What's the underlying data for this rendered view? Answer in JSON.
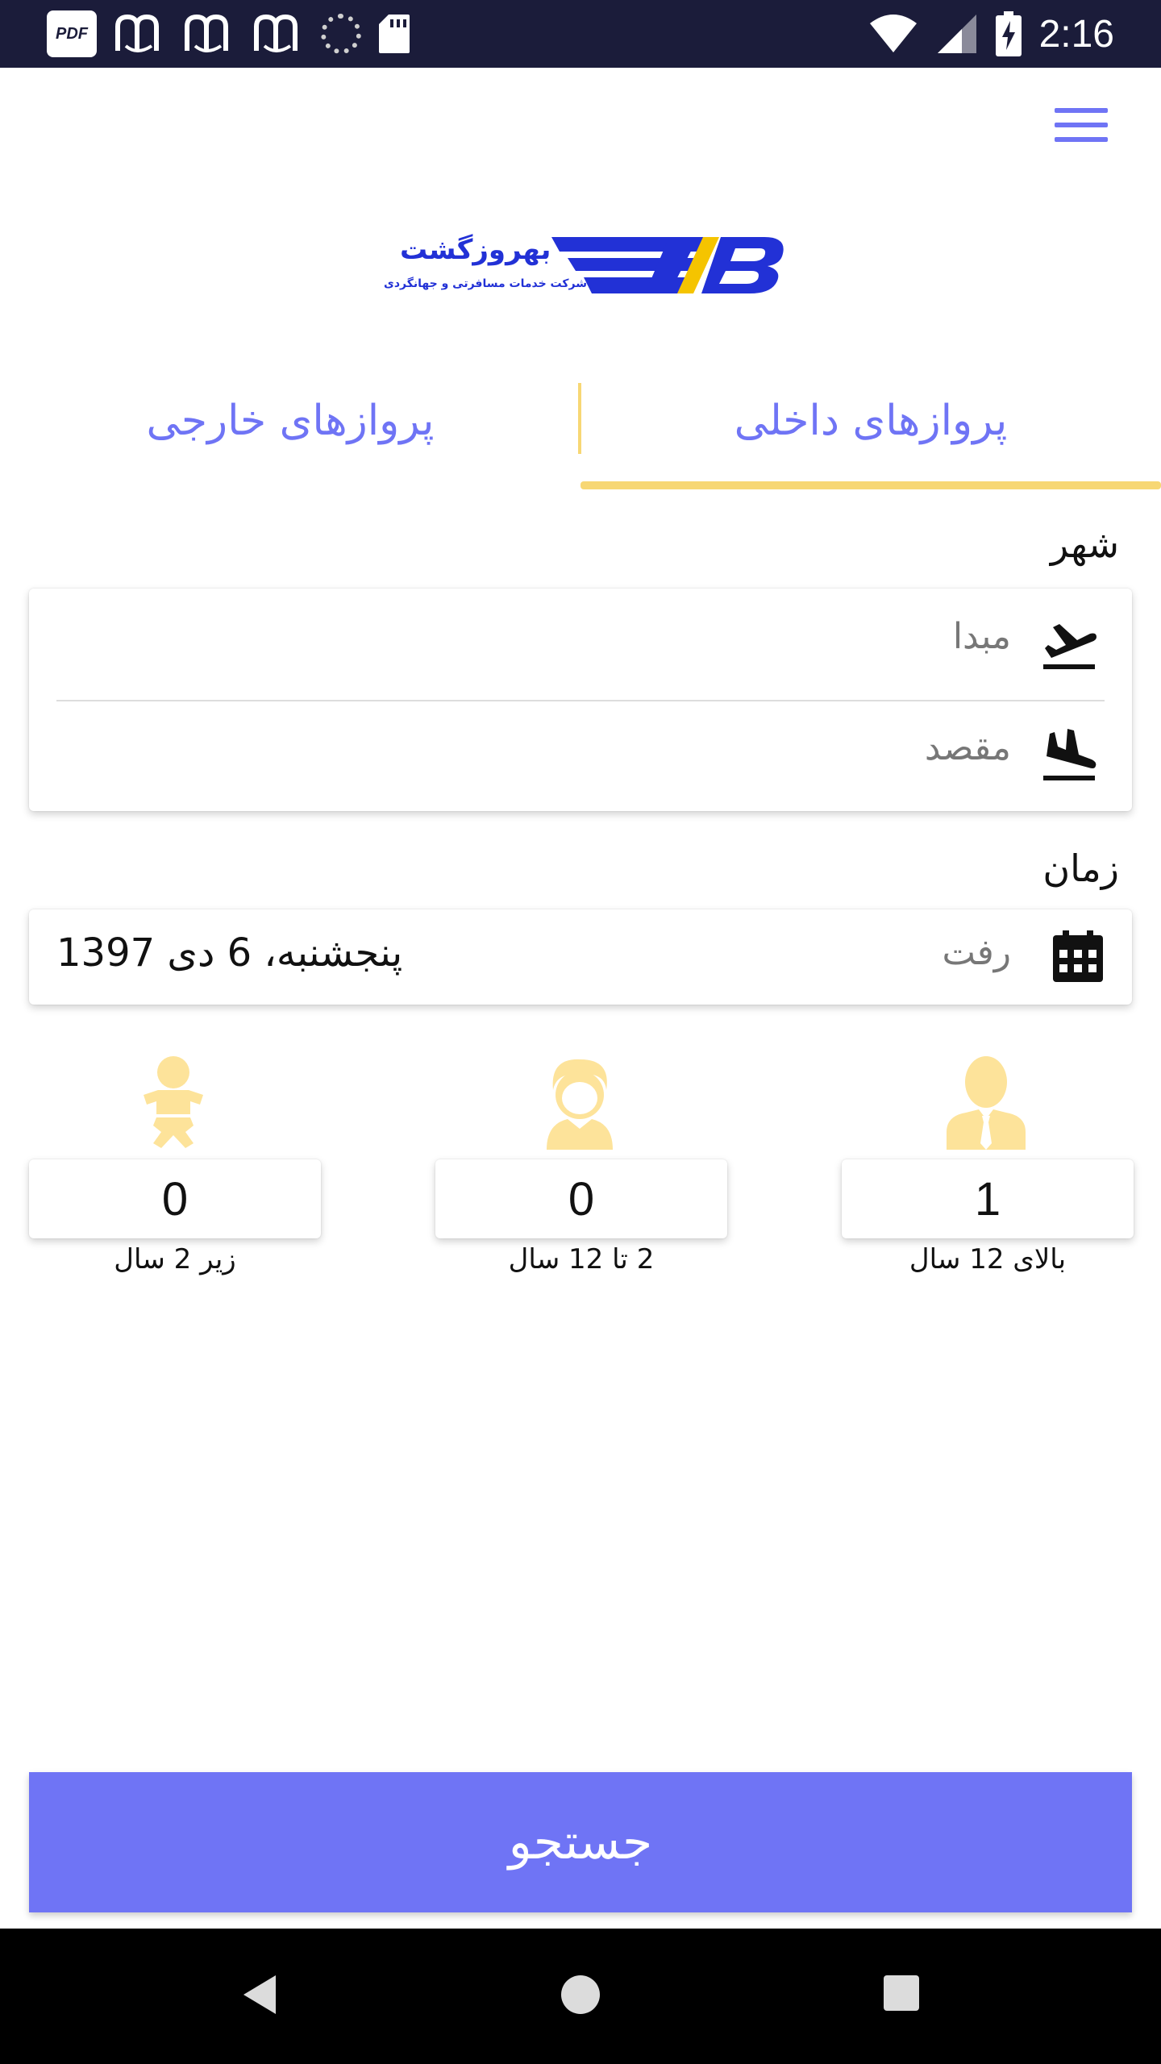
{
  "status_bar": {
    "time": "2:16",
    "icons": [
      "pdf-icon",
      "m-app-icon",
      "m-app-icon",
      "m-app-icon",
      "spinner-icon",
      "sd-card-icon",
      "wifi-icon",
      "cell-signal-icon",
      "battery-charging-icon"
    ],
    "pdf_text": "PDF"
  },
  "header": {
    "menu_icon": "hamburger-icon"
  },
  "logo": {
    "title": "بهروزگشت",
    "subtitle": "شرکت خدمات مسافرتی و جهانگردی",
    "colors": {
      "blue": "#2231d6",
      "yellow": "#f5c400"
    }
  },
  "tabs": {
    "domestic": "پروازهای داخلی",
    "foreign": "پروازهای خارجی",
    "active": "domestic",
    "accent_color": "#f7d774"
  },
  "city": {
    "label": "شهر",
    "origin_placeholder": "مبدا",
    "destination_placeholder": "مقصد"
  },
  "time_section": {
    "label": "زمان",
    "depart_label": "رفت",
    "depart_date": "پنجشنبه، 6 دی 1397"
  },
  "passengers": {
    "adult": {
      "count": "1",
      "label": "بالای 12 سال",
      "icon": "adult-icon"
    },
    "child": {
      "count": "0",
      "label": "2 تا 12 سال",
      "icon": "child-icon"
    },
    "infant": {
      "count": "0",
      "label": "زیر 2 سال",
      "icon": "infant-icon"
    },
    "icon_color": "#fde39a"
  },
  "search": {
    "label": "جستجو",
    "color": "#6f74f5"
  }
}
